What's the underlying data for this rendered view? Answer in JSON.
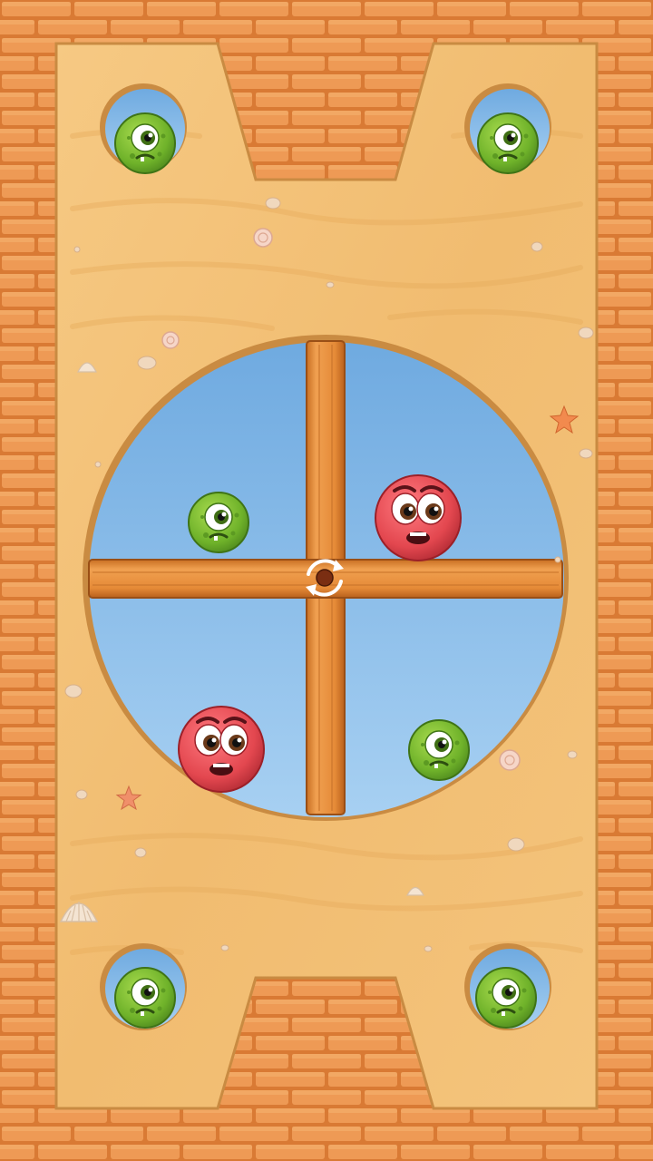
{
  "game": {
    "rotation_control_icon": "rotate-icon",
    "colors": {
      "brick": "#E9924C",
      "mortar": "#D97A34",
      "sand": "#F3C278",
      "sand_dark": "#E3A453",
      "sky": "#7FB6E6",
      "wood": "#E58A37",
      "green_monster": "#74B72E",
      "red_monster": "#E3474F"
    },
    "monsters": [
      {
        "id": "corner-top-left",
        "type": "green-monster-icon"
      },
      {
        "id": "corner-top-right",
        "type": "green-monster-icon"
      },
      {
        "id": "corner-bottom-left",
        "type": "green-monster-icon"
      },
      {
        "id": "corner-bottom-right",
        "type": "green-monster-icon"
      },
      {
        "id": "wheel-upper-left",
        "type": "green-monster-icon"
      },
      {
        "id": "wheel-upper-right",
        "type": "red-monster-icon"
      },
      {
        "id": "wheel-lower-left",
        "type": "red-monster-icon"
      },
      {
        "id": "wheel-lower-right",
        "type": "green-monster-icon"
      }
    ],
    "decorations": [
      "seashell-icon",
      "starfish-icon",
      "pebble-icon"
    ]
  }
}
